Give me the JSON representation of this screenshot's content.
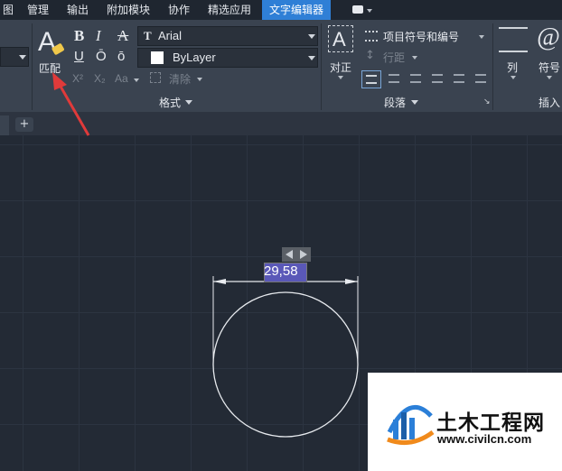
{
  "menu": {
    "items": [
      "图",
      "管理",
      "输出",
      "附加模块",
      "协作",
      "精选应用",
      "文字编辑器"
    ],
    "active_index": 6
  },
  "ribbon": {
    "match_label": "匹配",
    "bold": "B",
    "italic": "I",
    "strike": "A",
    "underline": "U",
    "overline": "Ō",
    "oblique": "ō",
    "superscript": "X²",
    "subscript": "X₂",
    "case_label": "Aa",
    "clear_label": "清除",
    "font_name": "Arial",
    "color_name": "ByLayer",
    "format_group": "格式",
    "justify_label": "对正",
    "bullets_label": "项目符号和编号",
    "linespacing_label": "行距",
    "paragraph_group": "段落",
    "columns_label": "列",
    "symbol_label": "符号",
    "insert_group": "插入"
  },
  "tabs": {
    "add_label": "+"
  },
  "canvas": {
    "dimension_value": "29,58"
  },
  "watermark": {
    "brand": "土木工程网",
    "url": "www.civilcn.com"
  },
  "colors": {
    "accent": "#2f7fd6",
    "arrow": "#e03a3a",
    "canvas_bg": "#232a35"
  }
}
